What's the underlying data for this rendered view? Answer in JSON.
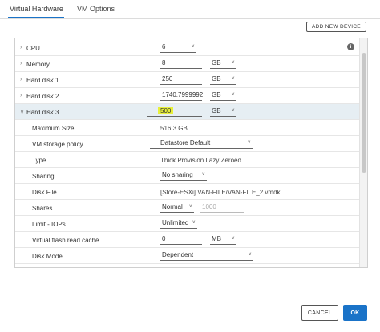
{
  "tabs": [
    {
      "label": "Virtual Hardware",
      "active": true
    },
    {
      "label": "VM Options",
      "active": false
    }
  ],
  "toolbar": {
    "add_device_label": "ADD NEW DEVICE",
    "info_icon": "info-icon"
  },
  "rows": {
    "cpu": {
      "label": "CPU",
      "value": "6"
    },
    "memory": {
      "label": "Memory",
      "value": "8",
      "unit": "GB"
    },
    "hd1": {
      "label": "Hard disk 1",
      "value": "250",
      "unit": "GB"
    },
    "hd2": {
      "label": "Hard disk 2",
      "value": "1740.7999992",
      "unit": "GB"
    },
    "hd3": {
      "label": "Hard disk 3",
      "value": "500",
      "unit": "GB"
    }
  },
  "hd3_details": {
    "max_size": {
      "label": "Maximum Size",
      "value": "516.3 GB"
    },
    "storage_policy": {
      "label": "VM storage policy",
      "value": "Datastore Default"
    },
    "type": {
      "label": "Type",
      "value": "Thick Provision Lazy Zeroed"
    },
    "sharing": {
      "label": "Sharing",
      "value": "No sharing"
    },
    "disk_file": {
      "label": "Disk File",
      "value": "[Store-ESXi] VAN-FILE/VAN-FILE_2.vmdk"
    },
    "shares": {
      "label": "Shares",
      "value": "Normal",
      "count": "1000"
    },
    "limit_iops": {
      "label": "Limit - IOPs",
      "value": "Unlimited"
    },
    "flash_cache": {
      "label": "Virtual flash read cache",
      "value": "0",
      "unit": "MB"
    },
    "disk_mode": {
      "label": "Disk Mode",
      "value": "Dependent"
    }
  },
  "footer": {
    "cancel_label": "CANCEL",
    "ok_label": "OK"
  },
  "colors": {
    "accent": "#1a73c8",
    "highlight": "#e8f03a",
    "expanded_row": "#e6eef3"
  }
}
